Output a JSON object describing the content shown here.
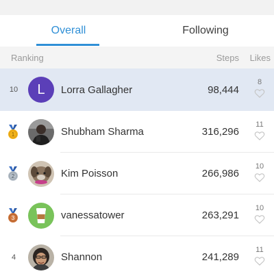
{
  "tabs": {
    "overall": "Overall",
    "following": "Following"
  },
  "header": {
    "ranking": "Ranking",
    "steps": "Steps",
    "likes": "Likes"
  },
  "rows": [
    {
      "rank": "10",
      "avatar_letter": "L",
      "name": "Lorra Gallagher",
      "steps": "98,444",
      "likes": "8"
    },
    {
      "rank": "1",
      "name": "Shubham Sharma",
      "steps": "316,296",
      "likes": "11"
    },
    {
      "rank": "2",
      "name": "Kim Poisson",
      "steps": "266,986",
      "likes": "10"
    },
    {
      "rank": "3",
      "name": "vanessatower",
      "steps": "263,291",
      "likes": "10"
    },
    {
      "rank": "4",
      "name": "Shannon",
      "steps": "241,289",
      "likes": "11"
    }
  ],
  "colors": {
    "accent": "#2f8fd6",
    "highlight_row": "#e1e8f3",
    "avatar_letter_bg": "#5b3fb8",
    "gold": "#f2b51c",
    "silver": "#b7c0c9",
    "bronze": "#d1783f"
  }
}
